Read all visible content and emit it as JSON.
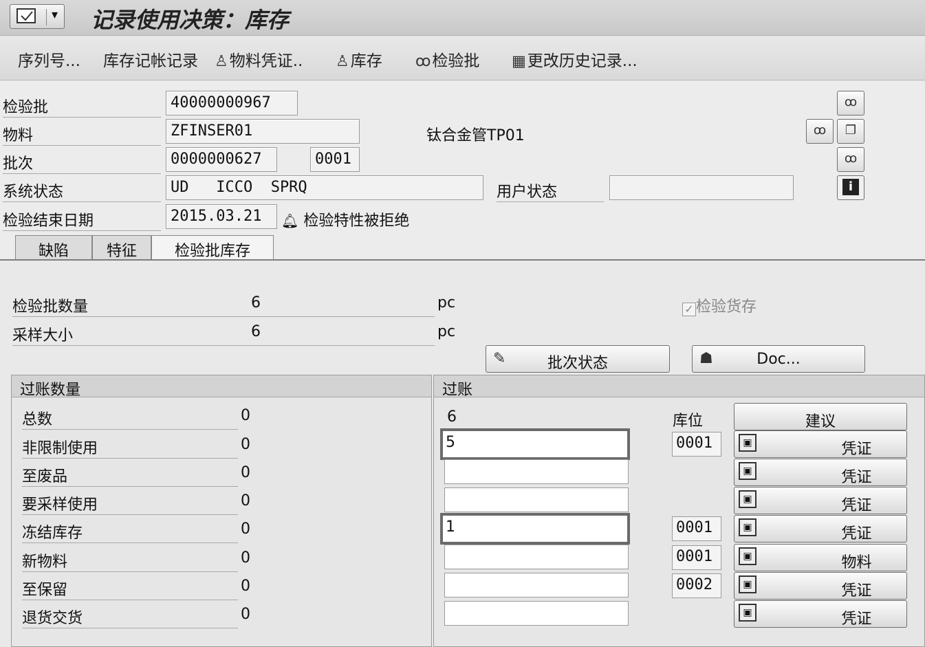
{
  "window": {
    "title": "记录使用决策：库存",
    "menu_arrow": "▾"
  },
  "toolbar": {
    "items": [
      {
        "label": "序列号..."
      },
      {
        "label": "库存记帐记录"
      },
      {
        "label": "物料凭证..",
        "icon": "person-icon"
      },
      {
        "label": "库存",
        "icon": "person-icon"
      },
      {
        "label": "检验批",
        "icon": "glasses-icon"
      },
      {
        "label": "更改历史记录...",
        "icon": "printer-icon"
      }
    ]
  },
  "header": {
    "inspection_lot": {
      "label": "检验批",
      "value": "40000000967"
    },
    "material": {
      "label": "物料",
      "value": "ZFINSER01",
      "description": "钛合金管TP01"
    },
    "batch": {
      "label": "批次",
      "value": "0000000627",
      "extra": "0001"
    },
    "system_status": {
      "label": "系统状态",
      "value": "UD   ICCO  SPRQ"
    },
    "user_status": {
      "label": "用户状态",
      "value": ""
    },
    "end_date": {
      "label": "检验结束日期",
      "value": "2015.03.21",
      "note": "检验特性被拒绝"
    }
  },
  "tabs": [
    {
      "label": "缺陷",
      "active": false
    },
    {
      "label": "特征",
      "active": false
    },
    {
      "label": "检验批库存",
      "active": true
    }
  ],
  "content": {
    "lot_quantity": {
      "label": "检验批数量",
      "value": "6",
      "unit": "pc"
    },
    "sample_size": {
      "label": "采样大小",
      "value": "6",
      "unit": "pc"
    },
    "inspection_stock": {
      "label": "检验货存",
      "checked": true
    },
    "batch_status_button": "批次状态",
    "doc_button": "Doc...",
    "posting_quantities": {
      "title": "过账数量",
      "rows": [
        {
          "label": "总数",
          "value": "0"
        },
        {
          "label": "非限制使用",
          "value": "0"
        },
        {
          "label": "至废品",
          "value": "0"
        },
        {
          "label": "要采样使用",
          "value": "0"
        },
        {
          "label": "冻结库存",
          "value": "0"
        },
        {
          "label": "新物料",
          "value": "0"
        },
        {
          "label": "至保留",
          "value": "0"
        },
        {
          "label": "退货交货",
          "value": "0"
        }
      ]
    },
    "posting": {
      "title": "过账",
      "total": "6",
      "storage_location_label": "库位",
      "suggest_button": "建议",
      "rows": [
        {
          "qty": "5",
          "location": "0001",
          "button": "凭证"
        },
        {
          "qty": "",
          "location": "",
          "button": "凭证"
        },
        {
          "qty": "",
          "location": "",
          "button": "凭证"
        },
        {
          "qty": "1",
          "location": "0001",
          "button": "凭证"
        },
        {
          "qty": "",
          "location": "0001",
          "button": "物料"
        },
        {
          "qty": "",
          "location": "0002",
          "button": "凭证"
        },
        {
          "qty": "",
          "location": "",
          "button": "凭证"
        }
      ]
    }
  }
}
